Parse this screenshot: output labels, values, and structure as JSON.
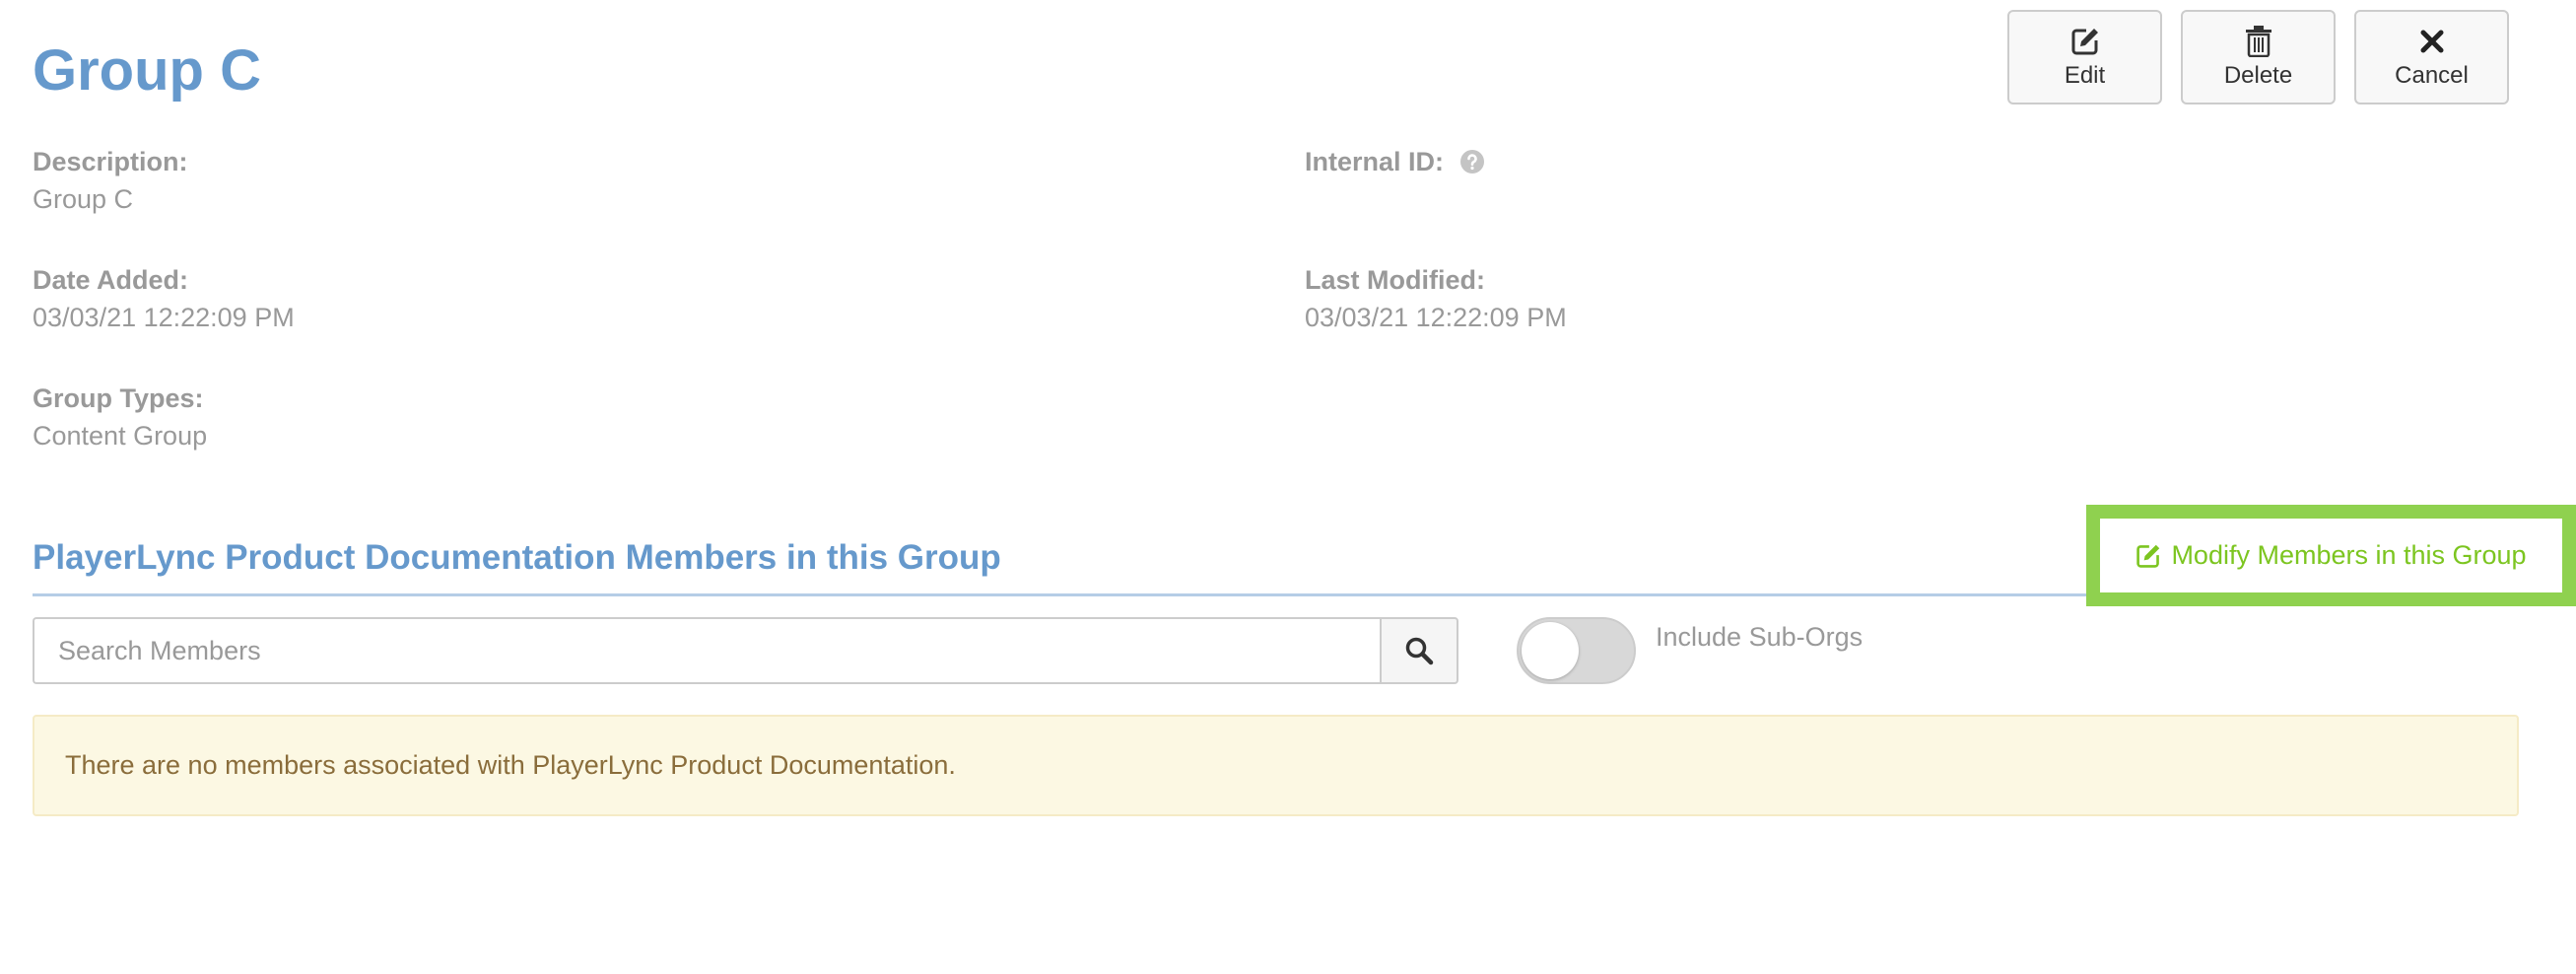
{
  "page": {
    "title": "Group C"
  },
  "toolbar": {
    "edit_label": "Edit",
    "delete_label": "Delete",
    "cancel_label": "Cancel"
  },
  "details": {
    "description_label": "Description:",
    "description_value": "Group C",
    "internal_id_label": "Internal ID:",
    "date_added_label": "Date Added:",
    "date_added_value": "03/03/21 12:22:09 PM",
    "last_modified_label": "Last Modified:",
    "last_modified_value": "03/03/21 12:22:09 PM",
    "group_types_label": "Group Types:",
    "group_types_value": "Content Group"
  },
  "members": {
    "section_title": "PlayerLync Product Documentation Members in this Group",
    "modify_label": "Modify Members in this Group",
    "search_placeholder": "Search Members",
    "include_suborgs_label": "Include Sub-Orgs",
    "include_suborgs_on": false,
    "empty_message": "There are no members associated with PlayerLync Product Documentation."
  },
  "icons": {
    "edit": "edit-icon",
    "delete": "trash-icon",
    "cancel": "close-icon",
    "help": "question-circle-icon",
    "search": "search-icon",
    "modify": "edit-icon"
  },
  "colors": {
    "title_blue": "#6699cc",
    "modify_green": "#7cc520",
    "highlight_green": "#8fd14f",
    "alert_bg": "#fcf8e3",
    "alert_text": "#8a6d3b"
  }
}
